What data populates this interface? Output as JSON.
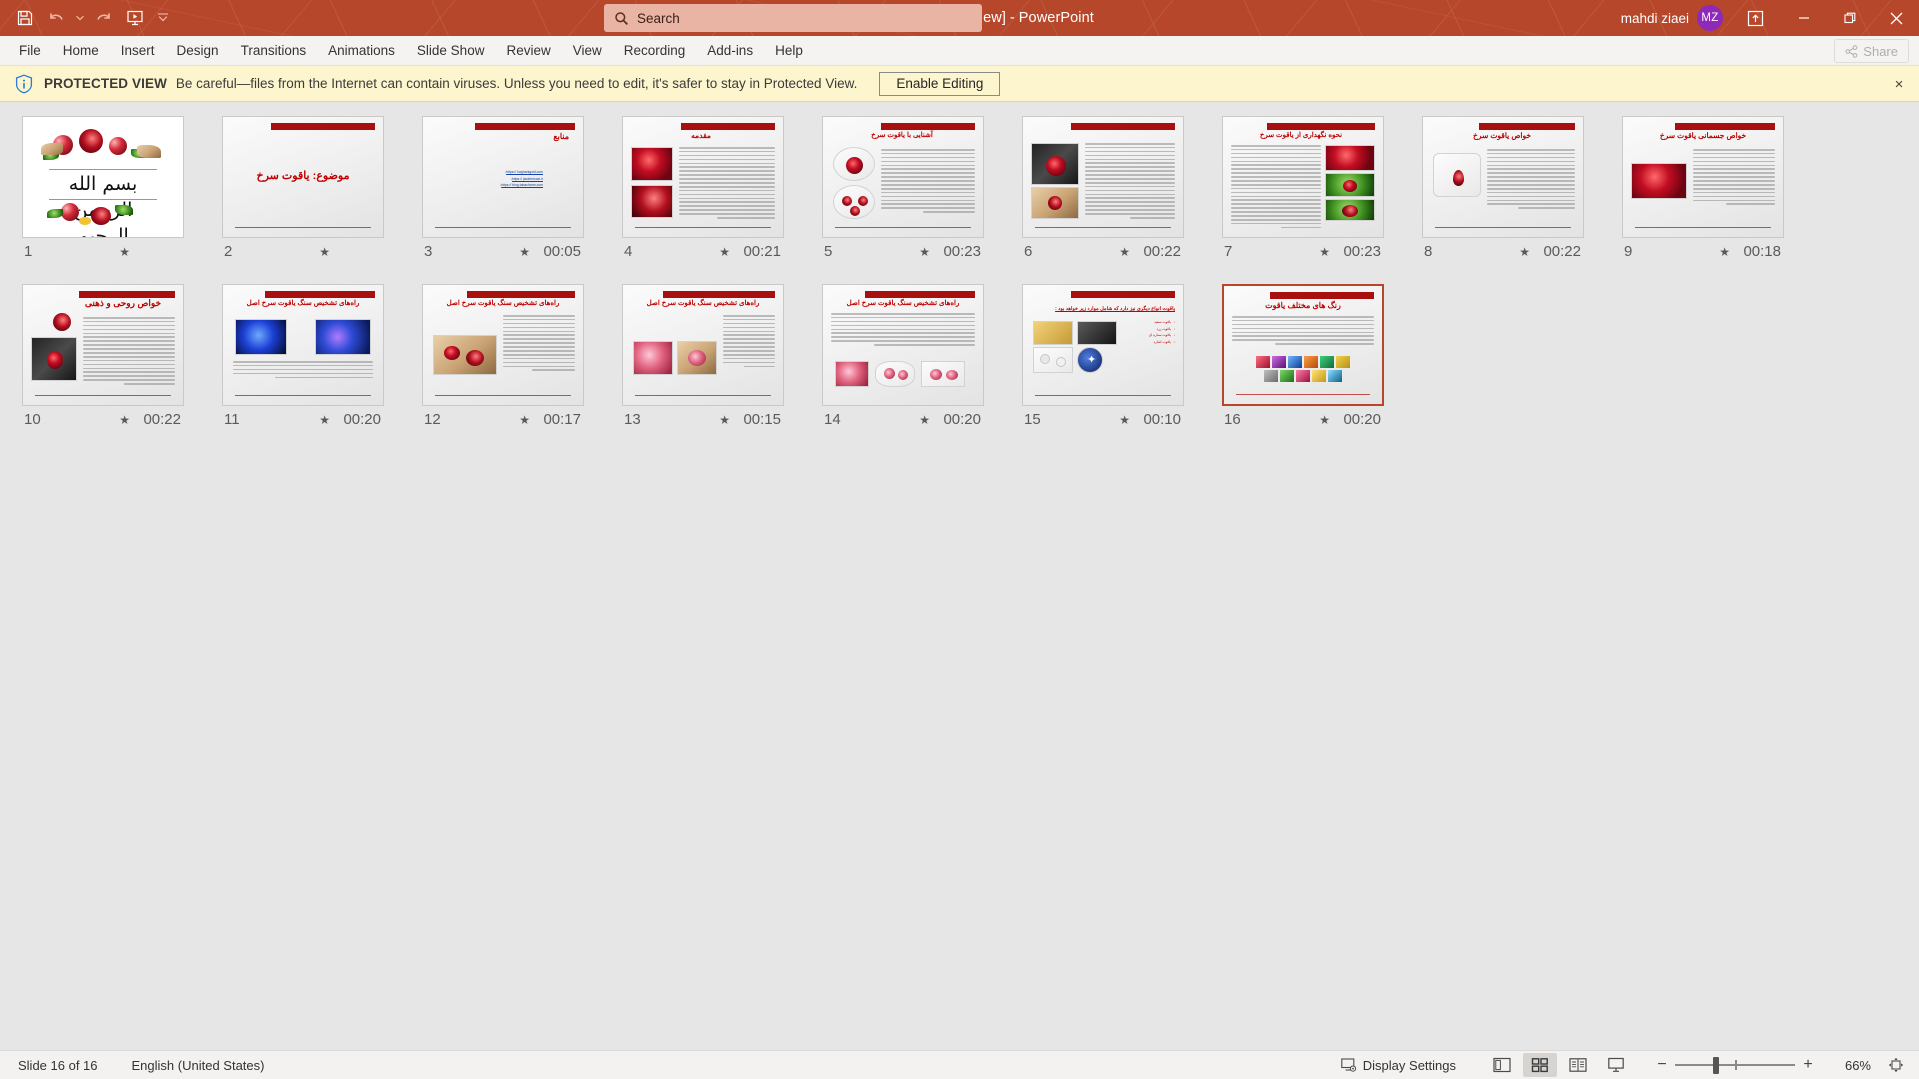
{
  "titlebar": {
    "document_title": "یاقوت سرخ [Protected View]  -  PowerPoint",
    "user_name": "mahdi ziaei",
    "avatar_initials": "MZ",
    "accent_color": "#b7472a",
    "avatar_color": "#8e29b8",
    "quick_access": [
      {
        "name": "save-icon",
        "label": "Save"
      },
      {
        "name": "undo-icon",
        "label": "Undo"
      },
      {
        "name": "redo-icon",
        "label": "Redo"
      },
      {
        "name": "start-presentation-icon",
        "label": "Start From Beginning"
      },
      {
        "name": "customize-qat-icon",
        "label": "Customize Quick Access Toolbar"
      }
    ],
    "window_controls": [
      {
        "name": "ribbon-display-options-icon",
        "label": "Ribbon Display Options"
      },
      {
        "name": "minimize-icon",
        "label": "Minimize"
      },
      {
        "name": "restore-icon",
        "label": "Restore Down"
      },
      {
        "name": "close-icon",
        "label": "Close"
      }
    ]
  },
  "search": {
    "placeholder": "Search",
    "value": "Search"
  },
  "menubar": {
    "items": [
      "File",
      "Home",
      "Insert",
      "Design",
      "Transitions",
      "Animations",
      "Slide Show",
      "Review",
      "View",
      "Recording",
      "Add-ins",
      "Help"
    ],
    "share_label": "Share"
  },
  "protected_view": {
    "label": "PROTECTED VIEW",
    "message": "Be careful—files from the Internet can contain viruses. Unless you need to edit, it's safer to stay in Protected View.",
    "enable_button": "Enable Editing",
    "close_label": "×",
    "background": "#fdf5cd"
  },
  "slides": [
    {
      "number": "1",
      "time": "",
      "star": true,
      "title": "",
      "type": "bismillah",
      "selected": false
    },
    {
      "number": "2",
      "time": "",
      "star": true,
      "title": "موضوع: یاقوت سرخ",
      "type": "title-only",
      "selected": false
    },
    {
      "number": "3",
      "time": "00:05",
      "star": true,
      "title": "منابع",
      "type": "links",
      "selected": false,
      "links": [
        "https:// haghanigold.com",
        "https:// javahersazi.ir",
        "https:// blog.tabacharm.com"
      ]
    },
    {
      "number": "4",
      "time": "00:21",
      "star": true,
      "title": "مقدمه",
      "type": "img-left-text",
      "selected": false
    },
    {
      "number": "5",
      "time": "00:23",
      "star": true,
      "title": "آشنایی با یاقوت سرخ",
      "type": "img-left-text",
      "selected": false
    },
    {
      "number": "6",
      "time": "00:22",
      "star": true,
      "title": "",
      "type": "img-left-text-notitle",
      "selected": false
    },
    {
      "number": "7",
      "time": "00:23",
      "star": true,
      "title": "نحوه نگهداری از یاقوت سرخ",
      "type": "img-left-text",
      "selected": false
    },
    {
      "number": "8",
      "time": "00:22",
      "star": true,
      "title": "خواص یاقوت سرخ",
      "type": "img-left-text",
      "selected": false
    },
    {
      "number": "9",
      "time": "00:18",
      "star": true,
      "title": "خواص جسمانی یاقوت سرخ",
      "type": "img-left-text",
      "selected": false
    },
    {
      "number": "10",
      "time": "00:22",
      "star": true,
      "title": "خواص روحی و ذهنی",
      "type": "img-left-text",
      "selected": false
    },
    {
      "number": "11",
      "time": "00:20",
      "star": true,
      "title": "راه‌های تشخیص سنگ یاقوت سرخ اصل",
      "type": "two-img",
      "selected": false
    },
    {
      "number": "12",
      "time": "00:17",
      "star": true,
      "title": "راه‌های تشخیص سنگ یاقوت سرخ اصل",
      "type": "img-left-text",
      "selected": false
    },
    {
      "number": "13",
      "time": "00:15",
      "star": true,
      "title": "راه‌های تشخیص سنگ یاقوت سرخ اصل",
      "type": "img-left-text",
      "selected": false
    },
    {
      "number": "14",
      "time": "00:20",
      "star": true,
      "title": "راه‌های تشخیص سنگ یاقوت سرخ اصل",
      "type": "three-img",
      "selected": false
    },
    {
      "number": "15",
      "time": "00:10",
      "star": true,
      "title": "یاقوت انواع دیگری نیز دارد که شامل موارد زیر خواهد بود :",
      "type": "list-img",
      "selected": false,
      "bullets": [
        "یاقوت سفید",
        "یاقوت زرد",
        "یاقوت ستاره ای",
        "یاقوت اشارد"
      ]
    },
    {
      "number": "16",
      "time": "00:20",
      "star": true,
      "title": "رنگ های مختلف یاقوت",
      "type": "gems-row",
      "selected": true
    }
  ],
  "statusbar": {
    "slide_counter": "Slide 16 of 16",
    "language": "English (United States)",
    "display_settings": "Display Settings",
    "views": [
      {
        "name": "normal-view-icon",
        "label": "Normal",
        "active": false
      },
      {
        "name": "slide-sorter-view-icon",
        "label": "Slide Sorter",
        "active": true
      },
      {
        "name": "reading-view-icon",
        "label": "Reading View",
        "active": false
      },
      {
        "name": "slide-show-icon",
        "label": "Slide Show",
        "active": false
      }
    ],
    "zoom_out": "−",
    "zoom_in": "+",
    "zoom_level": "66%",
    "fit_label": "Fit slide to current window"
  }
}
